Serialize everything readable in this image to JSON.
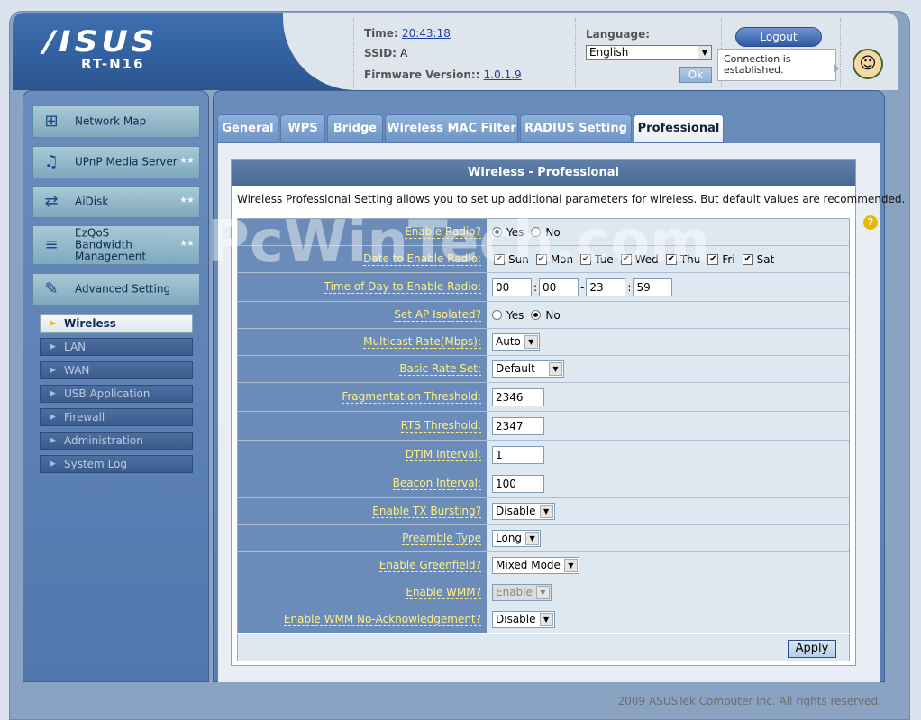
{
  "header": {
    "brand": "/ISUS",
    "model": "RT-N16",
    "time_label": "Time:",
    "time_value": "20:43:18",
    "ssid_label": "SSID:",
    "ssid_value": "A",
    "firmware_label": "Firmware Version::",
    "firmware_value": "1.0.1.9",
    "language_label": "Language:",
    "language_value": "English",
    "ok_label": "Ok",
    "logout_label": "Logout",
    "connection_status": "Connection is established."
  },
  "sidebar": {
    "main": [
      {
        "label": "Network Map",
        "icon": "network-map-icon",
        "stars": ""
      },
      {
        "label": "UPnP Media Server",
        "icon": "media-server-icon",
        "stars": "★★"
      },
      {
        "label": "AiDisk",
        "icon": "aidisk-icon",
        "stars": "★★"
      },
      {
        "label": "EzQoS Bandwidth Management",
        "icon": "qos-icon",
        "stars": "★★"
      },
      {
        "label": "Advanced Setting",
        "icon": "advanced-setting-icon",
        "stars": ""
      }
    ],
    "sub": [
      {
        "label": "Wireless",
        "active": true
      },
      {
        "label": "LAN"
      },
      {
        "label": "WAN"
      },
      {
        "label": "USB Application"
      },
      {
        "label": "Firewall"
      },
      {
        "label": "Administration"
      },
      {
        "label": "System Log"
      }
    ]
  },
  "tabs": [
    "General",
    "WPS",
    "Bridge",
    "Wireless MAC Filter",
    "RADIUS Setting",
    "Professional"
  ],
  "active_tab": "Professional",
  "panel": {
    "title": "Wireless - Professional",
    "description": "Wireless Professional Setting allows you to set up additional parameters for wireless. But default values are recommended."
  },
  "form": {
    "enable_radio": {
      "label": "Enable Radio?",
      "yes": "Yes",
      "no": "No",
      "selected": "Yes"
    },
    "date_enable_radio": {
      "label": "Date to Enable Radio:",
      "days": [
        "Sun",
        "Mon",
        "Tue",
        "Wed",
        "Thu",
        "Fri",
        "Sat"
      ]
    },
    "time_enable_radio": {
      "label": "Time of Day to Enable Radio:",
      "start_h": "00",
      "start_m": "00",
      "end_h": "23",
      "end_m": "59",
      "sep1": ":",
      "dash": "-",
      "sep2": ":"
    },
    "ap_isolated": {
      "label": "Set AP Isolated?",
      "yes": "Yes",
      "no": "No",
      "selected": "No"
    },
    "multicast_rate": {
      "label": "Multicast Rate(Mbps):",
      "value": "Auto"
    },
    "basic_rate": {
      "label": "Basic Rate Set:",
      "value": "Default"
    },
    "frag_threshold": {
      "label": "Fragmentation Threshold:",
      "value": "2346"
    },
    "rts_threshold": {
      "label": "RTS Threshold:",
      "value": "2347"
    },
    "dtim": {
      "label": "DTIM Interval:",
      "value": "1"
    },
    "beacon": {
      "label": "Beacon Interval:",
      "value": "100"
    },
    "tx_bursting": {
      "label": "Enable TX Bursting?",
      "value": "Disable"
    },
    "preamble": {
      "label": "Preamble Type",
      "value": "Long"
    },
    "greenfield": {
      "label": "Enable Greenfield?",
      "value": "Mixed Mode"
    },
    "wmm": {
      "label": "Enable WMM?",
      "value": "Enable"
    },
    "wmm_noack": {
      "label": "Enable WMM No-Acknowledgement?",
      "value": "Disable"
    }
  },
  "apply_label": "Apply",
  "help_glyph": "?",
  "footer": "2009 ASUSTek Computer Inc. All rights reserved.",
  "watermark": "PcWinTech.com"
}
